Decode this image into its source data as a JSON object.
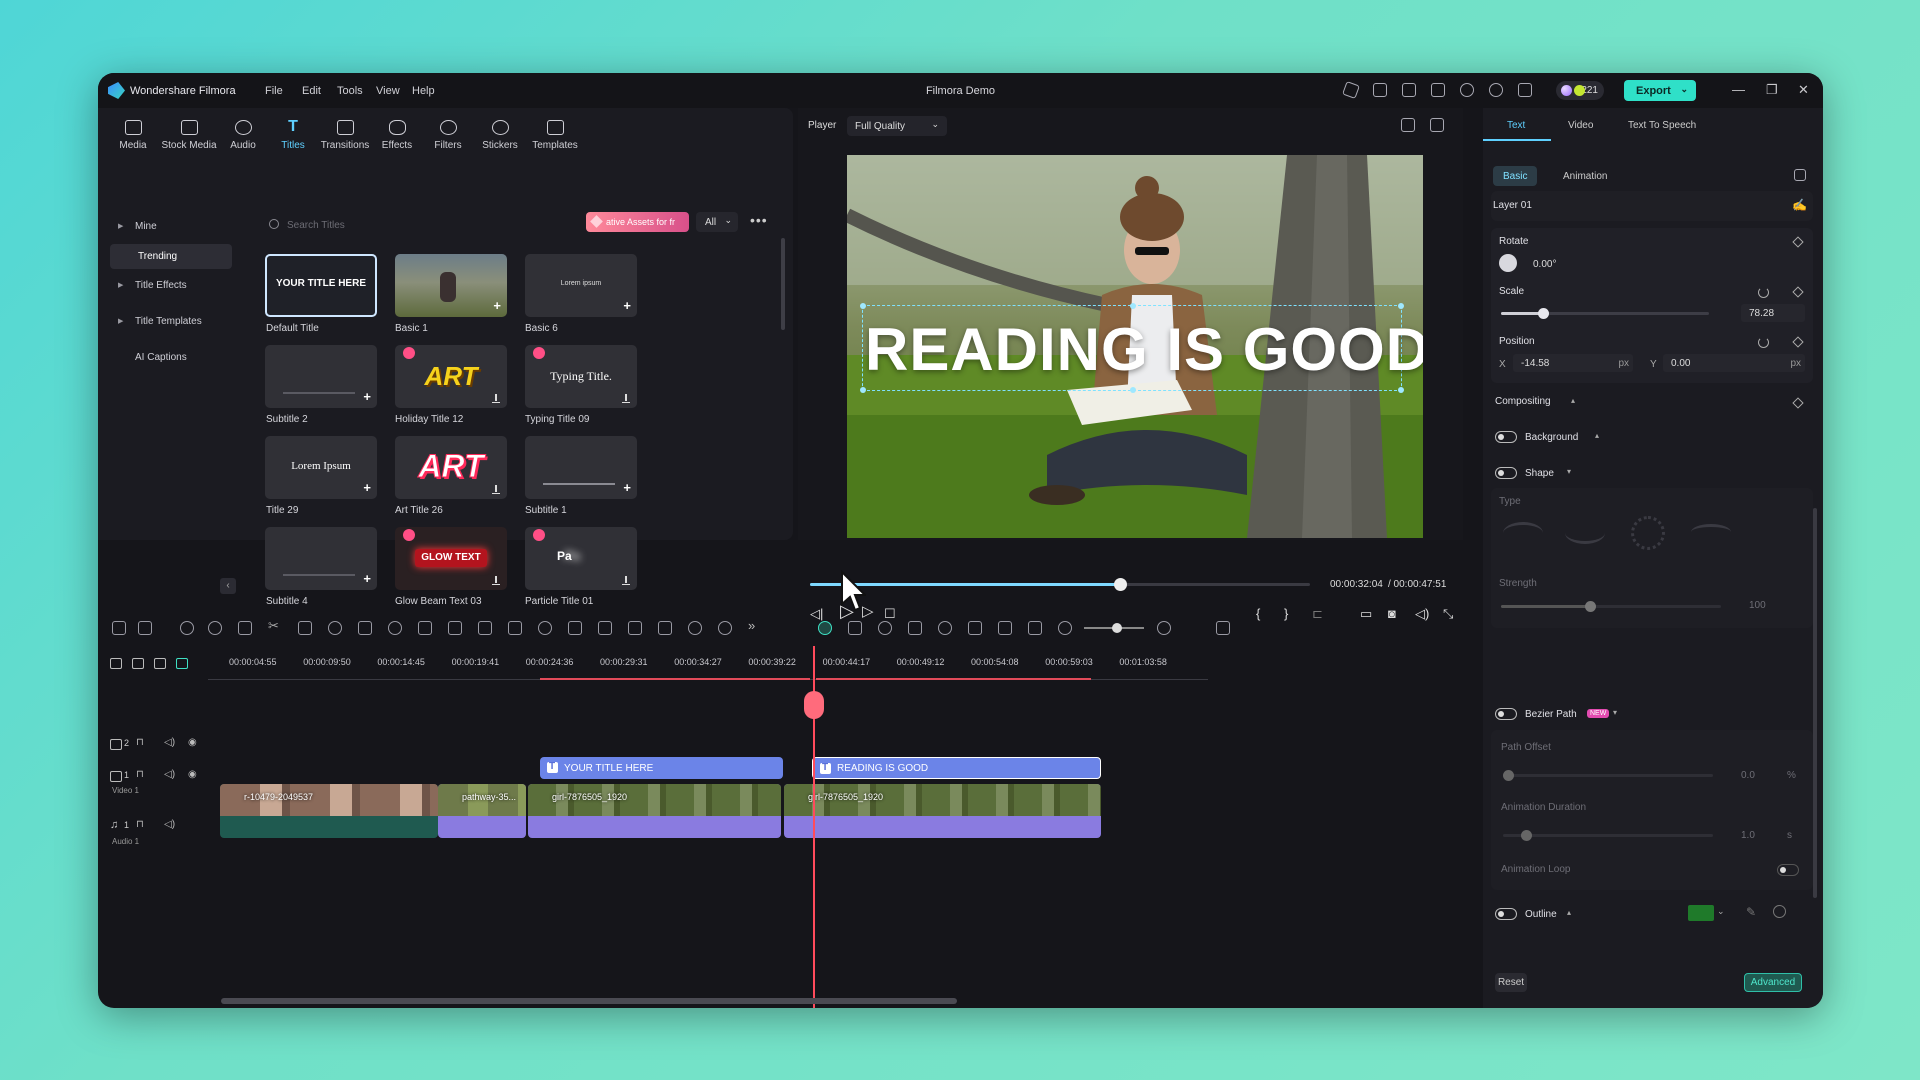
{
  "window": {
    "app_name": "Wondershare Filmora",
    "title": "Filmora Demo",
    "credits": "221",
    "export_label": "Export"
  },
  "menu": [
    "File",
    "Edit",
    "Tools",
    "View",
    "Help"
  ],
  "tools": [
    {
      "label": "Media",
      "icon": "media-icon"
    },
    {
      "label": "Stock Media",
      "icon": "stock-media-icon"
    },
    {
      "label": "Audio",
      "icon": "audio-icon"
    },
    {
      "label": "Titles",
      "icon": "titles-icon",
      "active": true
    },
    {
      "label": "Transitions",
      "icon": "transitions-icon"
    },
    {
      "label": "Effects",
      "icon": "effects-icon"
    },
    {
      "label": "Filters",
      "icon": "filters-icon"
    },
    {
      "label": "Stickers",
      "icon": "stickers-icon"
    },
    {
      "label": "Templates",
      "icon": "templates-icon"
    }
  ],
  "sidebar": [
    {
      "label": "Mine",
      "expand": true
    },
    {
      "label": "Trending",
      "active": true
    },
    {
      "label": "Title Effects",
      "expand": true
    },
    {
      "label": "Title Templates",
      "expand": true
    },
    {
      "label": "AI Captions"
    }
  ],
  "search": {
    "placeholder": "Search Titles"
  },
  "promo_label": "ative Assets for fr",
  "filter_value": "All",
  "cards": [
    {
      "label": "Default Title",
      "preview": "YOUR TITLE HERE"
    },
    {
      "label": "Basic 1",
      "preview": ""
    },
    {
      "label": "Basic 6",
      "preview": "Lorem ipsum"
    },
    {
      "label": "Subtitle 2",
      "preview": ""
    },
    {
      "label": "Holiday Title 12",
      "preview": "ART"
    },
    {
      "label": "Typing Title 09",
      "preview": "Typing Title."
    },
    {
      "label": "Title 29",
      "preview": "Lorem Ipsum"
    },
    {
      "label": "Art Title 26",
      "preview": "ART"
    },
    {
      "label": "Subtitle 1",
      "preview": ""
    },
    {
      "label": "Subtitle 4",
      "preview": ""
    },
    {
      "label": "Glow Beam Text 03",
      "preview": "GLOW TEXT"
    },
    {
      "label": "Particle Title 01",
      "preview": "Pa"
    }
  ],
  "player": {
    "label": "Player",
    "quality": "Full Quality",
    "overlay_title": "READING IS GOOD",
    "current_time": "00:00:32:04",
    "total_time": "/ 00:00:47:51",
    "progress": 0.62
  },
  "right": {
    "tabs": [
      "Text",
      "Video",
      "Text To Speech"
    ],
    "subtabs": [
      "Basic",
      "Animation"
    ],
    "layer": "Layer 01",
    "rotate_label": "Rotate",
    "rotate_value": "0.00°",
    "scale_label": "Scale",
    "scale_value": "78.28",
    "scale_fraction": 0.2,
    "position_label": "Position",
    "x_label": "X",
    "x_value": "-14.58",
    "y_label": "Y",
    "y_value": "0.00",
    "unit": "px",
    "compositing": "Compositing",
    "background": "Background",
    "shape": "Shape",
    "type_label": "Type",
    "strength_label": "Strength",
    "strength_value": "100",
    "bezier": "Bezier Path",
    "new_badge": "NEW",
    "path_offset": "Path Offset",
    "path_offset_value": "0.0",
    "percent": "%",
    "anim_duration": "Animation Duration",
    "anim_duration_value": "1.0",
    "seconds": "s",
    "anim_loop": "Animation Loop",
    "outline": "Outline",
    "outline_color": "#1f7a2a",
    "reset": "Reset",
    "advanced": "Advanced"
  },
  "timeline": {
    "ticks": [
      "00:00:04:55",
      "00:00:09:50",
      "00:00:14:45",
      "00:00:19:41",
      "00:00:24:36",
      "00:00:29:31",
      "00:00:34:27",
      "00:00:39:22",
      "00:00:44:17",
      "00:00:49:12",
      "00:00:54:08",
      "00:00:59:03",
      "00:01:03:58"
    ],
    "tracks": [
      {
        "num": "2",
        "name": ""
      },
      {
        "num": "1",
        "name": "Video 1"
      },
      {
        "num": "1",
        "name": "Audio 1"
      }
    ],
    "title_clips": [
      "YOUR TITLE HERE",
      "READING IS GOOD"
    ],
    "video_clips": [
      "r-10479-2049537",
      "pathway-35...",
      "girl-7876505_1920",
      "girl-7876505_1920"
    ]
  },
  "colors": {
    "accent": "#5fd0ff",
    "export": "#2fe0c8",
    "playhead": "#ff4b5c",
    "title_clip": "#6b84e8",
    "video_clip": "#8a7be0"
  }
}
